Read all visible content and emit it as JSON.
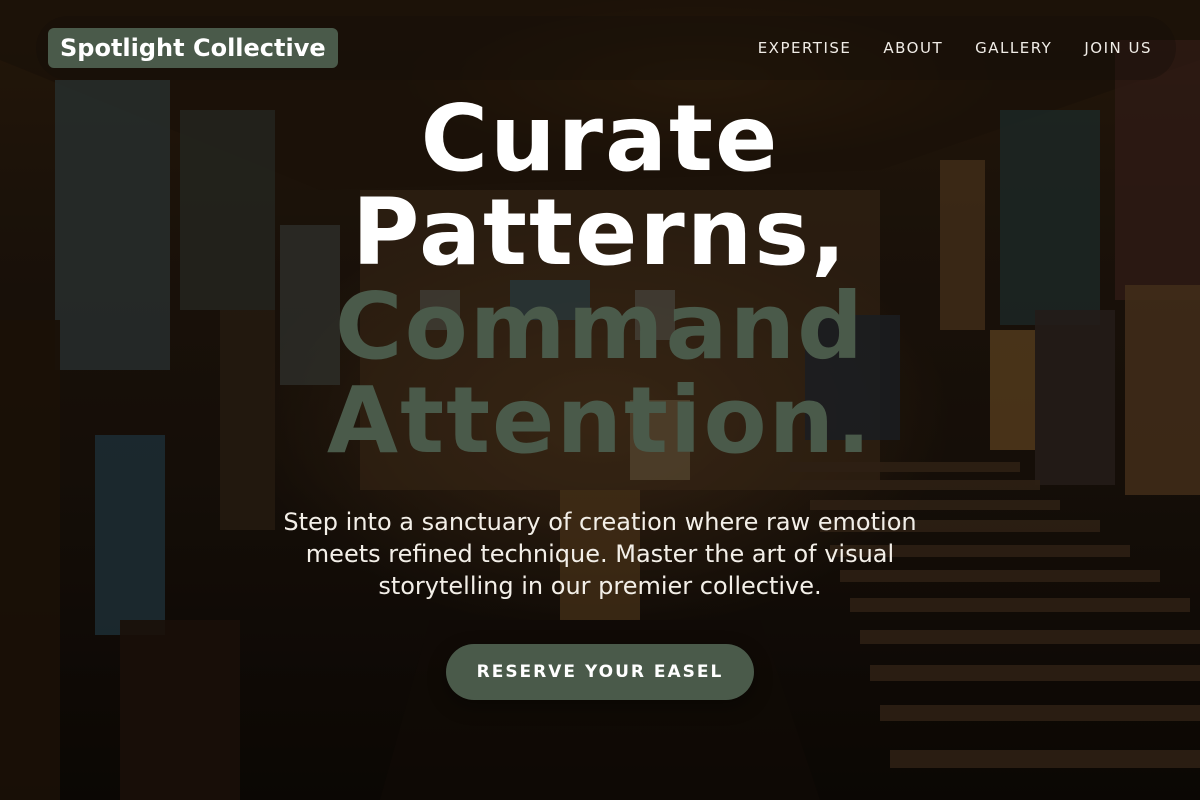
{
  "brand": {
    "name": "Spotlight Collective"
  },
  "nav": {
    "links": [
      "EXPERTISE",
      "ABOUT",
      "GALLERY",
      "JOIN US"
    ]
  },
  "hero": {
    "headline_line1": "Curate",
    "headline_line2": "Patterns,",
    "headline_line3": "Command",
    "headline_line4": "Attention.",
    "subcopy": "Step into a sanctuary of creation where raw emotion meets refined technique. Master the art of visual storytelling in our premier collective.",
    "cta_label": "RESERVE YOUR EASEL"
  },
  "colors": {
    "accent": "#4a5a4a",
    "headline_primary": "#ffffff",
    "text_light": "#f3efe8"
  },
  "background": {
    "subject": "art-storeroom-photo"
  }
}
